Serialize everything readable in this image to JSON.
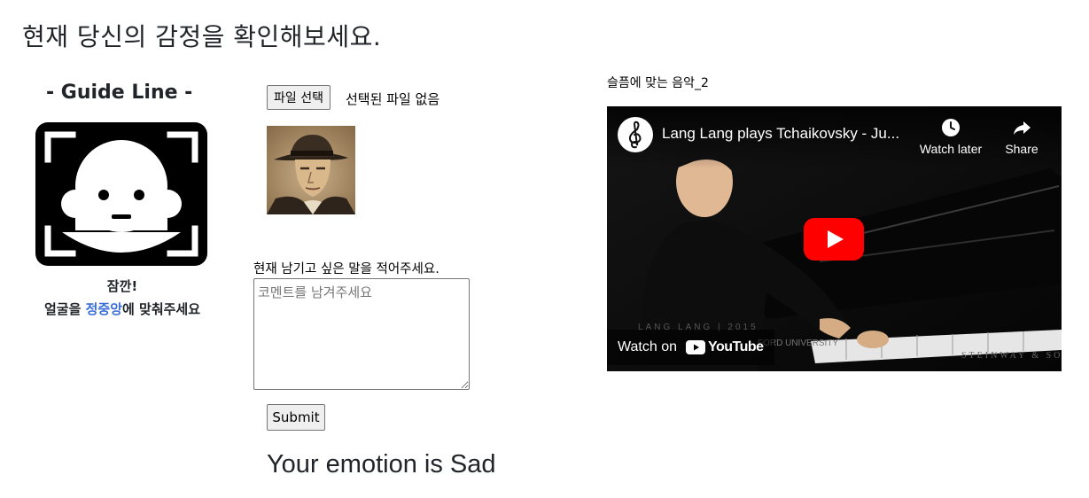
{
  "page": {
    "title": "현재 당신의 감정을 확인해보세요."
  },
  "guide": {
    "title": "- Guide Line -",
    "caption_line1": "잠깐!",
    "caption_line2_prefix": "얼굴을 ",
    "caption_line2_accent": "정중앙",
    "caption_line2_suffix": "에 맞춰주세요",
    "accent_color": "#3a6fd8"
  },
  "upload": {
    "button_label": "파일 선택",
    "status_text": "선택된 파일 없음",
    "photo_icon": "uploaded-portrait-photo"
  },
  "comment": {
    "label": "현재 남기고 싶은 말을 적어주세요.",
    "placeholder": "코멘트를 남겨주세요",
    "value": ""
  },
  "submit": {
    "label": "Submit"
  },
  "result": {
    "text": "Your emotion is Sad"
  },
  "music": {
    "label": "슬픔에 맞는 음악_2"
  },
  "video": {
    "title": "Lang Lang plays Tchaikovsky - Ju...",
    "watch_later_label": "Watch later",
    "share_label": "Share",
    "watch_on_label": "Watch on",
    "youtube_label": "YouTube",
    "play_color": "#ff0000",
    "channel_icon": "treble-clef-icon"
  }
}
